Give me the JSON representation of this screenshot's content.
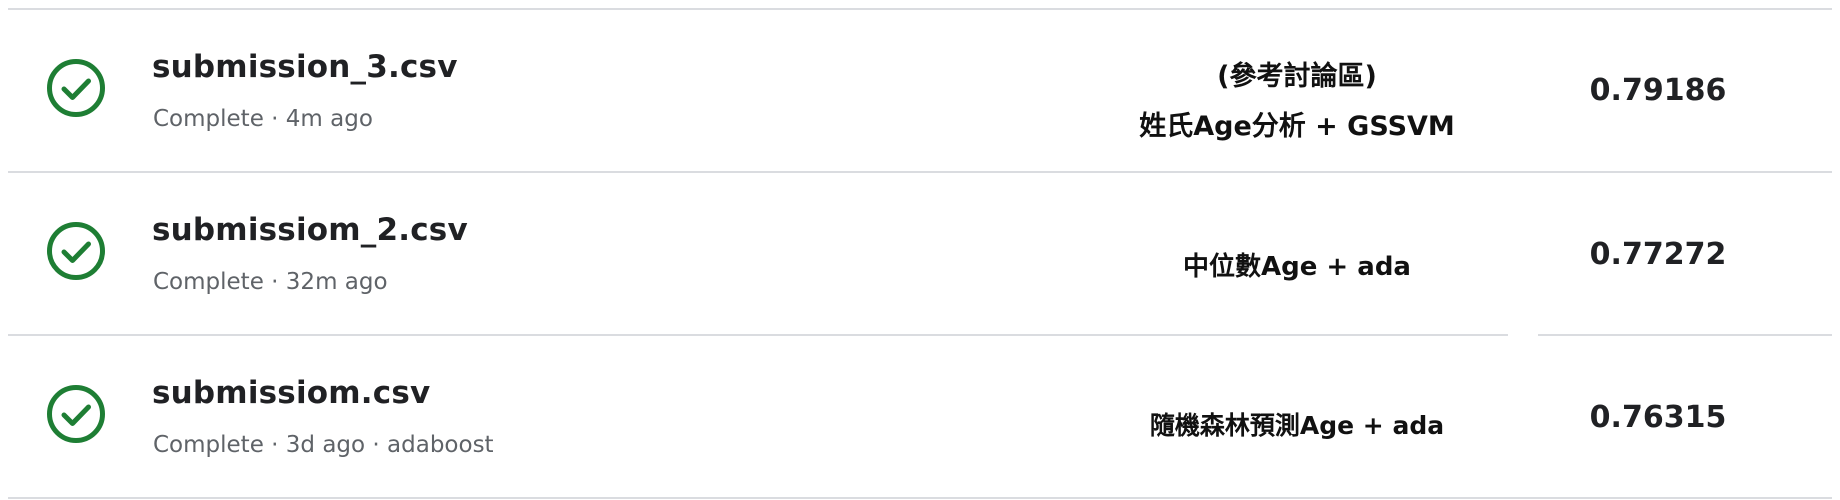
{
  "colors": {
    "success_green": "#1e7e34",
    "divider": "#dadce0",
    "primary_text": "#202124",
    "secondary_text": "#5f6368"
  },
  "submissions": [
    {
      "status_icon": "check-circle-icon",
      "file_name": "submission_3.csv",
      "status": "Complete",
      "age": "4m ago",
      "note": "",
      "description_lines": [
        "(參考討論區)",
        "姓氏Age分析 + GSSVM"
      ],
      "score": "0.79186"
    },
    {
      "status_icon": "check-circle-icon",
      "file_name": "submissiom_2.csv",
      "status": "Complete",
      "age": "32m ago",
      "note": "",
      "description_lines": [
        "中位數Age + ada"
      ],
      "score": "0.77272"
    },
    {
      "status_icon": "check-circle-icon",
      "file_name": "submissiom.csv",
      "status": "Complete",
      "age": "3d ago",
      "note": "adaboost",
      "description_lines": [
        "隨機森林預測Age + ada"
      ],
      "score": "0.76315"
    }
  ],
  "separator": " · "
}
